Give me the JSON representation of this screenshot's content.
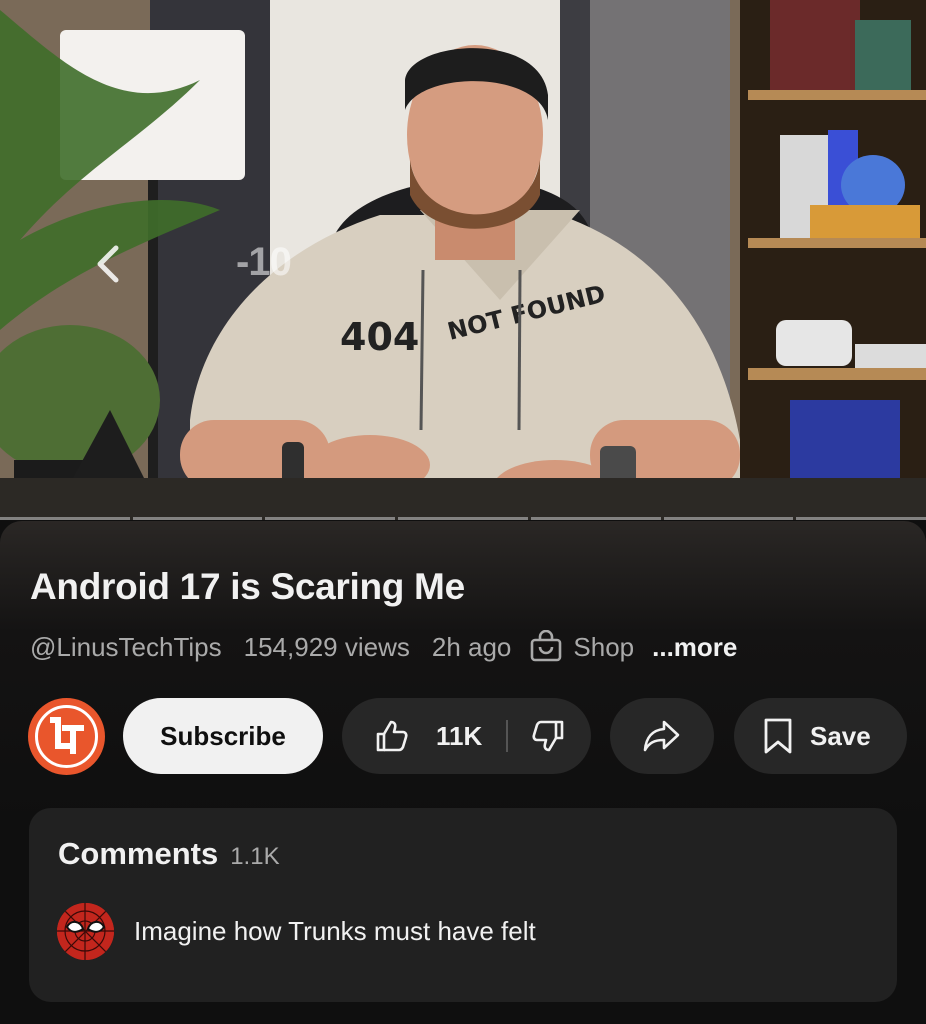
{
  "player": {
    "seek_label": "-10",
    "progress_segments": 7
  },
  "video": {
    "title": "Android 17 is Scaring Me",
    "channel_handle": "@LinusTechTips",
    "views": "154,929 views",
    "age": "2h ago",
    "shop_label": "Shop",
    "more_label": "...more"
  },
  "actions": {
    "subscribe_label": "Subscribe",
    "like_count": "11K",
    "save_label": "Save"
  },
  "comments": {
    "label": "Comments",
    "count": "1.1K",
    "top_comment": "Imagine how Trunks must have felt"
  },
  "colors": {
    "background": "#0f0f0f",
    "pill": "#272727",
    "subscribe_bg": "#f1f1f1",
    "channel_avatar": "#e9562c",
    "muted_text": "#aaaaaa"
  },
  "icons": {
    "seek": "chevron-left-icon",
    "shop": "shopping-bag-icon",
    "like": "thumbs-up-icon",
    "dislike": "thumbs-down-icon",
    "share": "share-arrow-icon",
    "save": "bookmark-icon"
  }
}
